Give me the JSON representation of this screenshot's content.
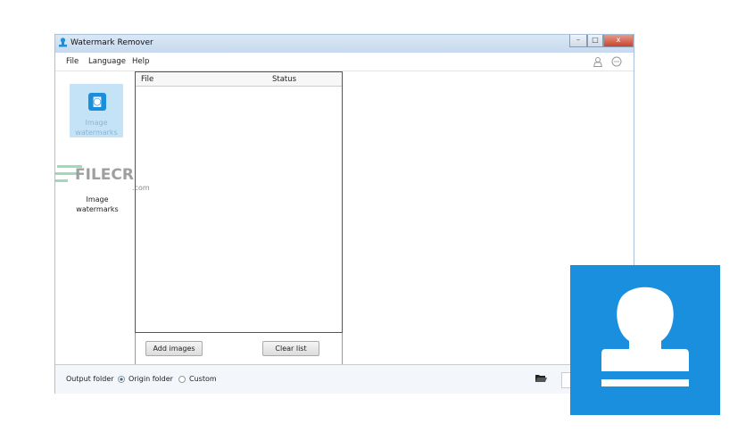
{
  "window": {
    "title": "Watermark Remover",
    "minimize": "–",
    "maximize": "□",
    "close": "x"
  },
  "menu": [
    "File",
    "Language",
    "Help"
  ],
  "toolbar_icons": [
    "user-icon",
    "chat-icon"
  ],
  "sidebar": {
    "items": [
      {
        "label_line1": "Image",
        "label_line2": "watermarks",
        "selected": true
      },
      {
        "label_line1": "Image",
        "label_line2": "watermarks",
        "selected": false
      }
    ]
  },
  "watermark_text": {
    "brand": "FILECR",
    "suffix": ".com"
  },
  "list": {
    "columns": [
      "File",
      "Status"
    ],
    "rows": []
  },
  "buttons": {
    "add": "Add images",
    "clear": "Clear list"
  },
  "output": {
    "label": "Output folder",
    "option1": "Origin folder",
    "option2": "Custom",
    "selected": "Origin folder"
  },
  "colors": {
    "accent": "#1a8fdd"
  }
}
